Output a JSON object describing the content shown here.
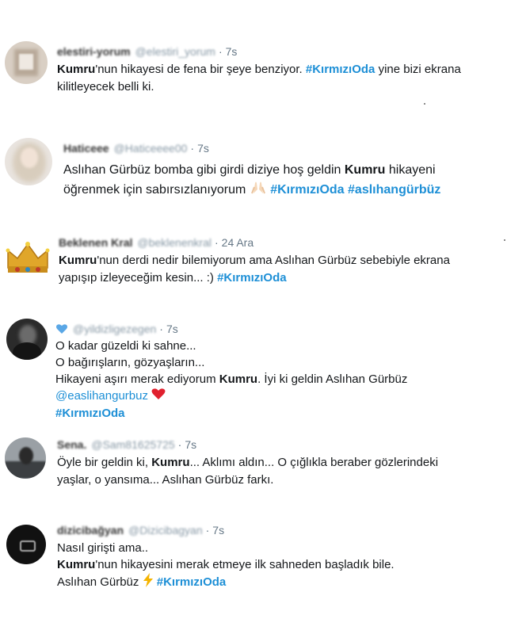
{
  "colors": {
    "hashtag": "#1d8fd6",
    "muted": "#657786",
    "text": "#14171a"
  },
  "tweets": [
    {
      "name": "elestiri-yorum",
      "handle": "@elestiri_yorum",
      "sep": "·",
      "time": "7s",
      "l1": {
        "b": "Kumru",
        "t": "'nun hikayesi de fena bir şeye benziyor. ",
        "tag": "#KırmızıOda",
        "t2": " yine bizi ekrana"
      },
      "l2": "kilitleyecek belli ki."
    },
    {
      "name": "Haticeee",
      "handle": "@Haticeeee00",
      "sep": "·",
      "time": "7s",
      "l1": {
        "t": "Aslıhan Gürbüz bomba gibi girdi diziye hoş geldin ",
        "b": "Kumru",
        "t2": " hikayeni"
      },
      "l2": {
        "t": "öğrenmek için sabırsızlanıyorum ",
        "emoji": "praying-hands",
        "tag1": "#KırmızıOda",
        "tag2": "#aslıhangürbüz"
      }
    },
    {
      "name": "Beklenen Kral",
      "handle": "@beklenenkral",
      "sep": "·",
      "time": "24 Ara",
      "l1": {
        "b": "Kumru",
        "t": "'nun derdi nedir bilemiyorum ama Aslıhan Gürbüz sebebiyle ekrana"
      },
      "l2": {
        "t": "yapışıp izleyeceğim kesin... :) ",
        "tag": "#KırmızıOda"
      }
    },
    {
      "name": "",
      "handle": "@yildizligezegen",
      "sep": "·",
      "time": "7s",
      "badge": "blue-heart",
      "l1": "O kadar güzeldi ki sahne...",
      "l2": "O bağırışların, gözyaşların...",
      "l3": {
        "t": "Hikayeni aşırı merak ediyorum ",
        "b": "Kumru",
        "t2": ". İyi ki geldin Aslıhan Gürbüz"
      },
      "l4": {
        "mention": "@easlihangurbuz",
        "emoji": "red-heart"
      },
      "l5": "#KırmızıOda"
    },
    {
      "name": "Sena.",
      "handle": "@Sam81625725",
      "sep": "·",
      "time": "7s",
      "l1": {
        "t": "Öyle bir geldin ki, ",
        "b": "Kumru",
        "t2": "... Aklımı aldın... O çığlıkla beraber gözlerindeki"
      },
      "l2": "yaşlar, o yansıma... Aslıhan Gürbüz farkı."
    },
    {
      "name": "dizicibağyan",
      "handle": "@Dizicibagyan",
      "sep": "·",
      "time": "7s",
      "l1": "Nasıl girişti ama..",
      "l2": {
        "b": "Kumru",
        "t": "'nun hikayesini merak etmeye ilk sahneden başladık bile."
      },
      "l3": {
        "t": "Aslıhan Gürbüz ",
        "emoji": "lightning",
        "tag": "#KırmızıOda"
      }
    }
  ]
}
